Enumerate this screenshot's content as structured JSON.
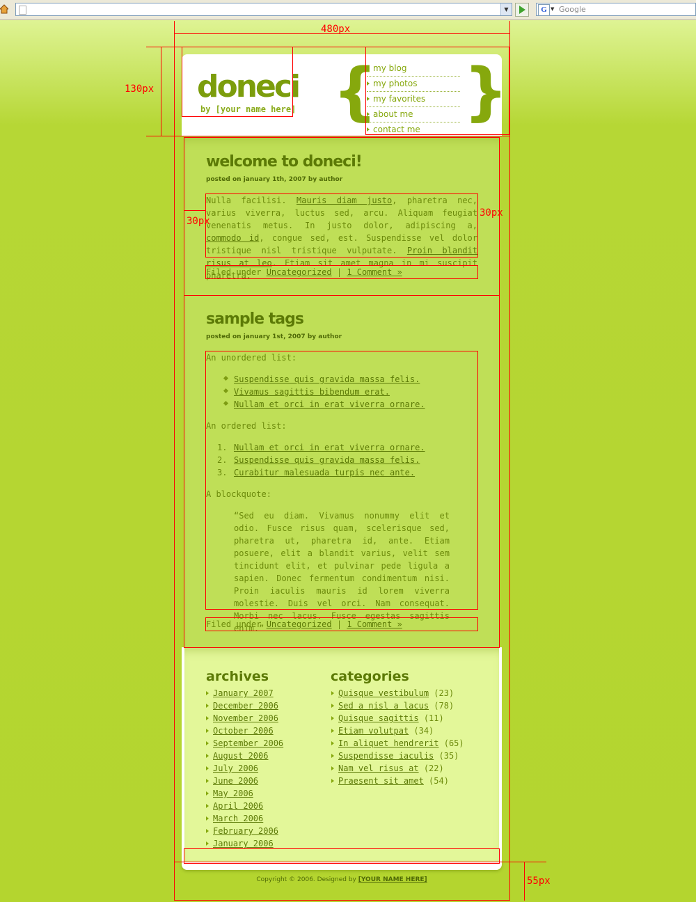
{
  "browser": {
    "url": "",
    "search_placeholder": "Google"
  },
  "annotations": {
    "width_label": "480px",
    "header_height_label": "130px",
    "padding_left_label": "30px",
    "padding_right_label": "30px",
    "footer_height_label": "55px"
  },
  "header": {
    "logo": "doneci",
    "tagline": "by [your name here]",
    "brace_left": "{",
    "brace_right": "}",
    "nav": [
      "my blog",
      "my photos",
      "my favorites",
      "about me",
      "contact me"
    ]
  },
  "post1": {
    "title": "welcome to doneci!",
    "meta": "posted on january 1th, 2007 by author",
    "text_1": "Nulla facilisi. ",
    "link_1": "Mauris diam justo",
    "text_2": ", pharetra nec, varius viverra, luctus sed, arcu. Aliquam feugiat venenatis metus. In justo dolor, adipiscing a, ",
    "link_2": "commodo id",
    "text_3": ", congue sed, est. Suspendisse vel dolor tristique nisl tristique vulputate. ",
    "link_3": "Proin blandit risus at leo",
    "text_4": ". Etiam sit amet magna in mi suscipit pharetra.",
    "filed_prefix": "Filed under ",
    "category": "Uncategorized",
    "separator": " | ",
    "comments": "1 Comment »"
  },
  "post2": {
    "title": "sample tags",
    "meta": "posted on january 1st, 2007 by author",
    "unordered_label": "An unordered list:",
    "unordered": [
      "Suspendisse quis gravida massa felis.",
      "Vivamus sagittis bibendum erat.",
      "Nullam et orci in erat viverra ornare."
    ],
    "ordered_label": "An ordered list:",
    "ordered_numbers": [
      "1.",
      "2.",
      "3."
    ],
    "ordered": [
      "Nullam et orci in erat viverra ornare.",
      "Suspendisse quis gravida massa felis.",
      "Curabitur malesuada turpis nec ante."
    ],
    "blockquote_label": "A blockquote:",
    "blockquote": "“Sed eu diam. Vivamus nonummy elit et odio. Fusce risus quam, scelerisque sed, pharetra ut, pharetra id, ante. Etiam posuere, elit a blandit varius, velit sem tincidunt elit, et pulvinar pede ligula a sapien. Donec fermentum condimentum nisi. Proin iaculis mauris id lorem viverra molestie. Duis vel orci. Nam consequat. Morbi nec lacus. Fusce egestas sagittis enim.”",
    "filed_prefix": "Filed under ",
    "category": "Uncategorized",
    "separator": " | ",
    "comments": "1 Comment »"
  },
  "archives": {
    "title": "archives",
    "items": [
      "January 2007",
      "December 2006",
      "November 2006",
      "October 2006",
      "September 2006",
      "August 2006",
      "July 2006",
      "June 2006",
      "May 2006",
      "April 2006",
      "March 2006",
      "February 2006",
      "January 2006"
    ]
  },
  "categories": {
    "title": "categories",
    "items": [
      {
        "name": "Quisque vestibulum",
        "count": " (23)"
      },
      {
        "name": "Sed a nisl a lacus",
        "count": " (78)"
      },
      {
        "name": "Quisque sagittis",
        "count": " (11)"
      },
      {
        "name": "Etiam volutpat",
        "count": " (34)"
      },
      {
        "name": "In aliquet hendrerit",
        "count": " (65)"
      },
      {
        "name": "Suspendisse iaculis",
        "count": " (35)"
      },
      {
        "name": "Nam vel risus at",
        "count": " (22)"
      },
      {
        "name": "Praesent sit amet",
        "count": " (54)"
      }
    ]
  },
  "footer": {
    "copyright": "Copyright © 2006. Designed by ",
    "designer": "[YOUR NAME HERE]"
  }
}
